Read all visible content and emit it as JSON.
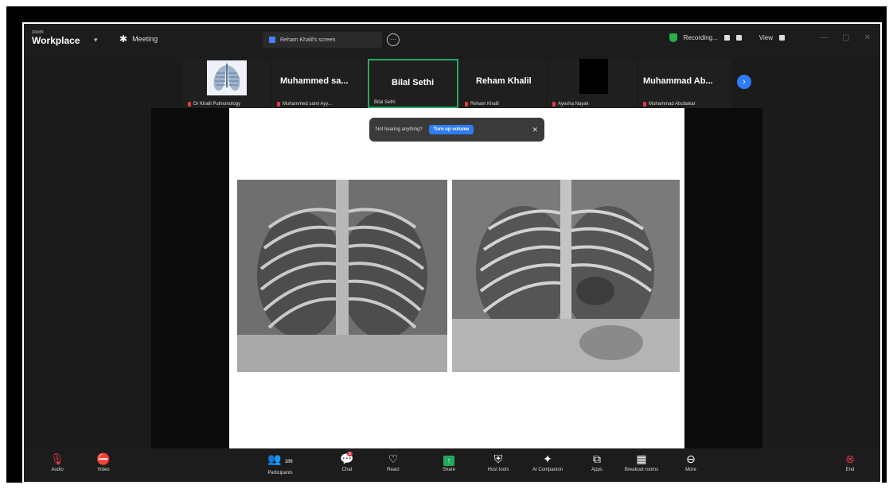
{
  "app": {
    "brand_small": "zoom",
    "brand": "Workplace",
    "meeting_label": "Meeting"
  },
  "screen_share_tab": {
    "label": "Reham Khalil's screen"
  },
  "status": {
    "recording": "Recording...",
    "view": "View"
  },
  "participants": [
    {
      "name": "",
      "label": "Dr Khalil Pulmonology"
    },
    {
      "name": "Muhammed sa...",
      "label": "Muhammed sami Ayy..."
    },
    {
      "name": "Bilal Sethi",
      "label": "Bilal Sethi"
    },
    {
      "name": "Reham Khalil",
      "label": "Reham Khalil"
    },
    {
      "name": "",
      "label": "Ayesha Nayak"
    },
    {
      "name": "Muhammad Ab...",
      "label": "Muhammad Abubakar"
    }
  ],
  "toast": {
    "text": "Not hearing anything?",
    "button": "Turn up volume"
  },
  "toolbar": {
    "audio": "Audio",
    "video": "Video",
    "participants": "Participants",
    "participants_count": "186",
    "chat": "Chat",
    "chat_badge": "9",
    "react": "React",
    "share": "Share",
    "host_tools": "Host tools",
    "ai_companion": "AI Companion",
    "apps": "Apps",
    "breakout": "Breakout rooms",
    "more": "More",
    "end": "End"
  },
  "colors": {
    "accent": "#2e7cf6",
    "active_border": "#2aa860",
    "mic_off": "#e0394a",
    "share_green": "#22a95a"
  }
}
